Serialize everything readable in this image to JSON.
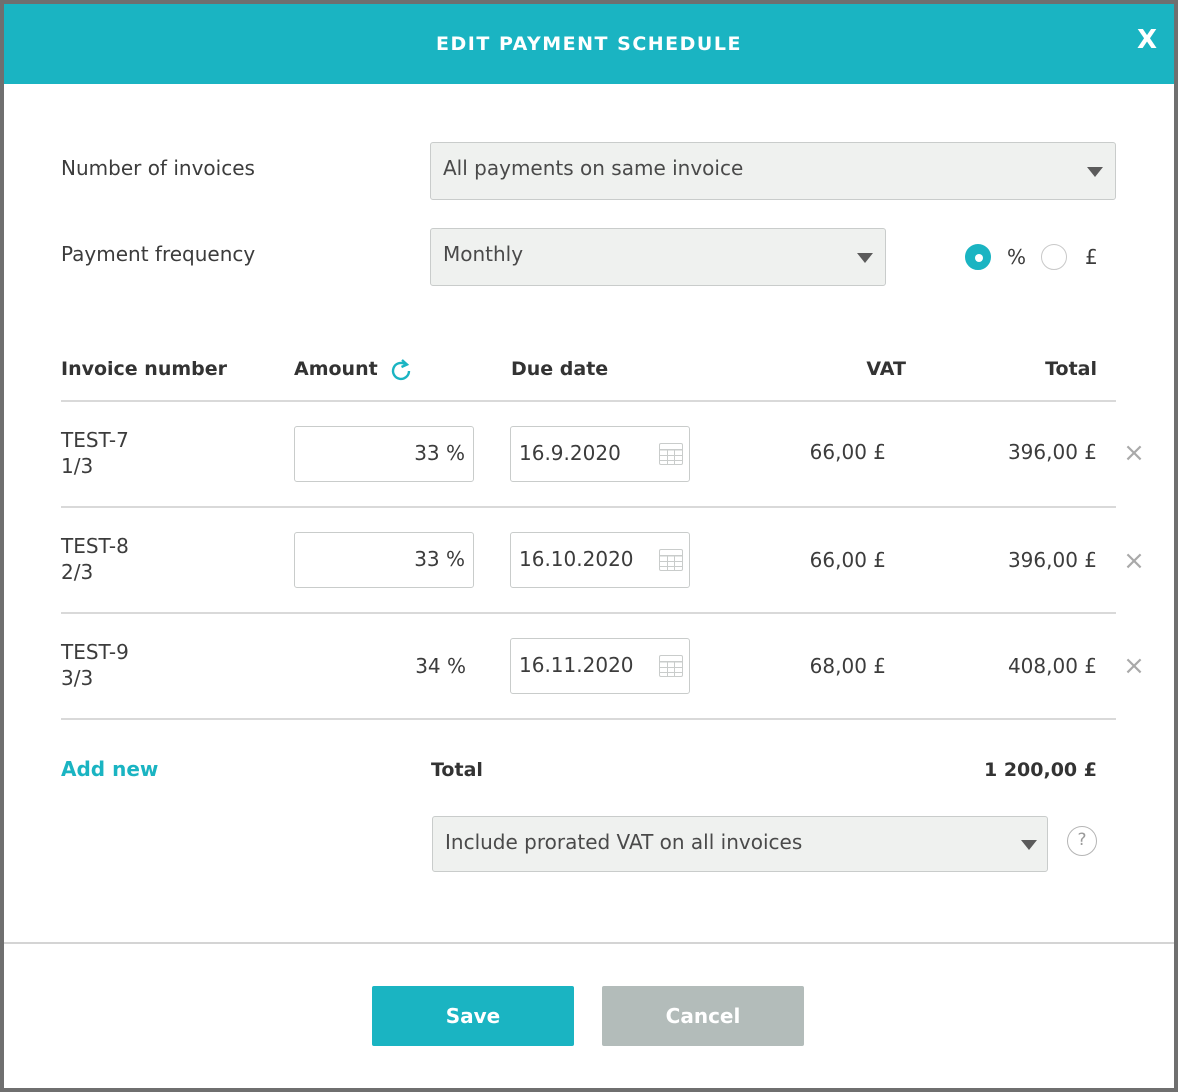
{
  "dialog": {
    "title": "EDIT PAYMENT SCHEDULE",
    "close_label": "X"
  },
  "form": {
    "number_of_invoices": {
      "label": "Number of invoices",
      "value": "All payments on same invoice"
    },
    "payment_frequency": {
      "label": "Payment frequency",
      "value": "Monthly"
    },
    "amount_mode": {
      "options": [
        {
          "label": "%",
          "checked": true
        },
        {
          "label": "£",
          "checked": false
        }
      ]
    }
  },
  "table": {
    "headers": {
      "invoice_number": "Invoice number",
      "amount": "Amount",
      "due_date": "Due date",
      "vat": "VAT",
      "total": "Total"
    },
    "rows": [
      {
        "invoice": "TEST-7",
        "part": "1/3",
        "amount": "33 %",
        "amount_editable": true,
        "due_date": "16.9.2020",
        "vat": "66,00 £",
        "total": "396,00 £"
      },
      {
        "invoice": "TEST-8",
        "part": "2/3",
        "amount": "33 %",
        "amount_editable": true,
        "due_date": "16.10.2020",
        "vat": "66,00 £",
        "total": "396,00 £"
      },
      {
        "invoice": "TEST-9",
        "part": "3/3",
        "amount": "34 %",
        "amount_editable": false,
        "due_date": "16.11.2020",
        "vat": "68,00 £",
        "total": "408,00 £"
      }
    ],
    "add_new_label": "Add new",
    "total_label": "Total",
    "total_value": "1 200,00 £"
  },
  "vat_option": {
    "value": "Include prorated VAT on all invoices",
    "help_label": "?"
  },
  "buttons": {
    "save_label": "Save",
    "cancel_label": "Cancel"
  },
  "colors": {
    "accent": "#1ab4c2",
    "cancel": "#b3bcba"
  }
}
